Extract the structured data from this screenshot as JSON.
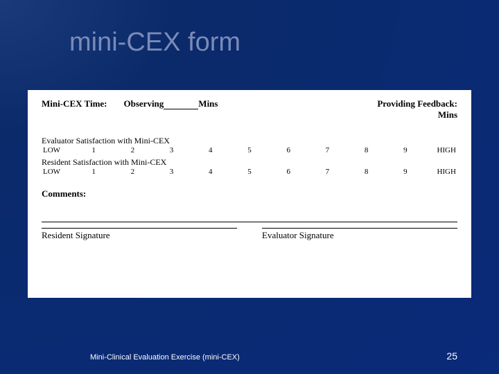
{
  "title": "mini-CEX form",
  "form": {
    "time_label": "Mini-CEX Time:",
    "observing_label": "Observing",
    "observing_suffix": "Mins",
    "feedback_label": "Providing Feedback:",
    "feedback_suffix": "Mins",
    "evaluator_satis_label": "Evaluator Satisfaction with Mini-CEX",
    "resident_satis_label": "Resident Satisfaction with Mini-CEX",
    "scale_low": "LOW",
    "scale_high": "HIGH",
    "scale_values": [
      "1",
      "2",
      "3",
      "4",
      "5",
      "6",
      "7",
      "8",
      "9"
    ],
    "comments_label": "Comments:",
    "resident_sig": "Resident Signature",
    "evaluator_sig": "Evaluator Signature"
  },
  "footer": {
    "left": "Mini-Clinical Evaluation Exercise (mini-CEX)",
    "page": "25"
  }
}
